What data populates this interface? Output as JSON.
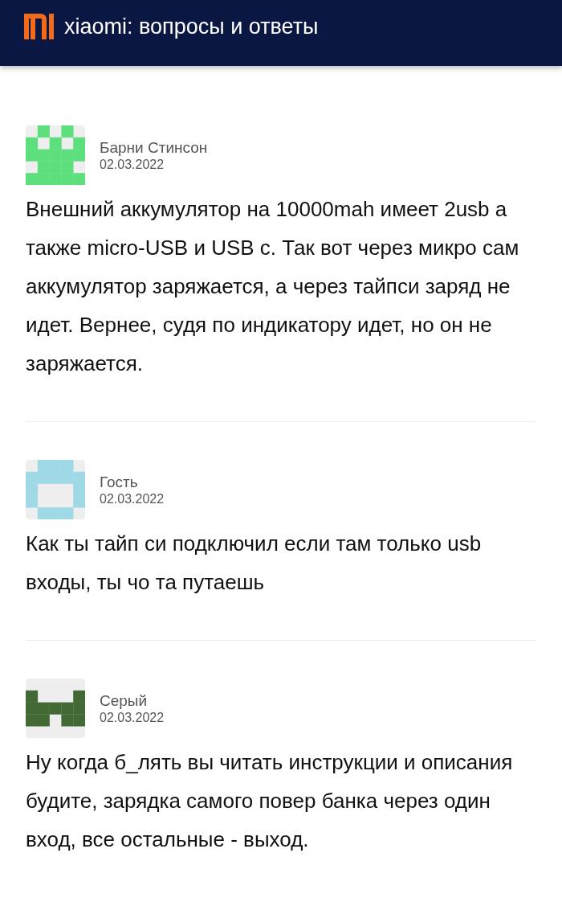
{
  "header": {
    "title": "xiaomi: вопросы и ответы"
  },
  "comments": [
    {
      "author": "Барни Стинсон",
      "date": "02.03.2022",
      "color": "#5ddf7d",
      "text": "Внешний аккумулятор на 10000mah имеет 2usb а также micro-USB и USB c. Так вот через микро сам аккумулятор заряжается, а через тайпси заряд не идет. Вернее, судя по индикатору идет, но он не заряжается."
    },
    {
      "author": "Гость",
      "date": "02.03.2022",
      "color": "#9fd9e6",
      "text": "Как ты тайп си подключил если там только usb входы, ты чо та путаешь"
    },
    {
      "author": "Серый",
      "date": "02.03.2022",
      "color": "#436a35",
      "text": "Ну когда б_лять вы читать инструкции и описания будите, зарядка самого повер банка через один вход, все остальные - выход."
    }
  ]
}
